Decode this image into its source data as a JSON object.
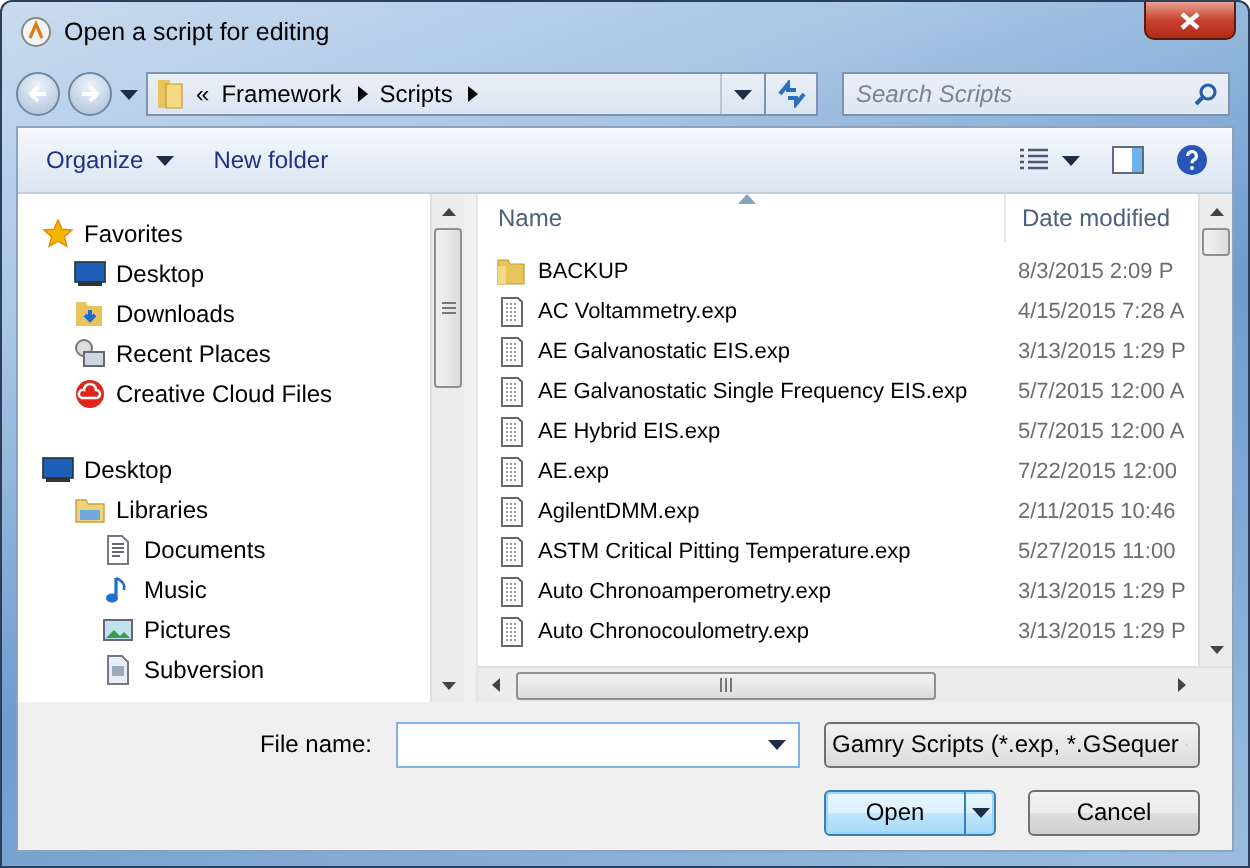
{
  "window": {
    "title": "Open a script for editing"
  },
  "address": {
    "overflow": "«",
    "crumbs": [
      "Framework",
      "Scripts"
    ]
  },
  "search": {
    "placeholder": "Search Scripts"
  },
  "toolbar": {
    "buttons": [
      {
        "label": "Organize",
        "dropdown": true
      },
      {
        "label": "New folder",
        "dropdown": false
      }
    ]
  },
  "sidebar": {
    "items": [
      {
        "label": "Favorites",
        "kind": "favorites",
        "children": [
          {
            "label": "Desktop",
            "kind": "desktop"
          },
          {
            "label": "Downloads",
            "kind": "downloads"
          },
          {
            "label": "Recent Places",
            "kind": "recent"
          },
          {
            "label": "Creative Cloud Files",
            "kind": "cloud"
          }
        ]
      },
      {
        "label": "Desktop",
        "kind": "desktop",
        "children": [
          {
            "label": "Libraries",
            "kind": "libraries",
            "children": [
              {
                "label": "Documents",
                "kind": "documents"
              },
              {
                "label": "Music",
                "kind": "music"
              },
              {
                "label": "Pictures",
                "kind": "pictures"
              },
              {
                "label": "Subversion",
                "kind": "subversion"
              }
            ]
          }
        ]
      }
    ]
  },
  "table": {
    "columns": [
      {
        "label": "Name",
        "sorted": true
      },
      {
        "label": "Date modified",
        "sorted": false
      }
    ],
    "rows": [
      {
        "name": "BACKUP",
        "kind": "folder",
        "date": "8/3/2015 2:09 P"
      },
      {
        "name": "AC Voltammetry.exp",
        "kind": "file",
        "date": "4/15/2015 7:28 A"
      },
      {
        "name": "AE Galvanostatic EIS.exp",
        "kind": "file",
        "date": "3/13/2015 1:29 P"
      },
      {
        "name": "AE Galvanostatic Single Frequency EIS.exp",
        "kind": "file",
        "date": "5/7/2015 12:00 A"
      },
      {
        "name": "AE Hybrid EIS.exp",
        "kind": "file",
        "date": "5/7/2015 12:00 A"
      },
      {
        "name": "AE.exp",
        "kind": "file",
        "date": "7/22/2015 12:00"
      },
      {
        "name": "AgilentDMM.exp",
        "kind": "file",
        "date": "2/11/2015 10:46"
      },
      {
        "name": "ASTM Critical Pitting Temperature.exp",
        "kind": "file",
        "date": "5/27/2015 11:00"
      },
      {
        "name": "Auto Chronoamperometry.exp",
        "kind": "file",
        "date": "3/13/2015 1:29 P"
      },
      {
        "name": "Auto Chronocoulometry.exp",
        "kind": "file",
        "date": "3/13/2015 1:29 P"
      }
    ]
  },
  "file_name": {
    "label": "File name:"
  },
  "file_type": {
    "value": "Gamry Scripts (*.exp, *.GSequer"
  },
  "buttons": [
    {
      "label": "Open",
      "default": true,
      "split": true
    },
    {
      "label": "Cancel",
      "default": false,
      "split": false
    }
  ]
}
